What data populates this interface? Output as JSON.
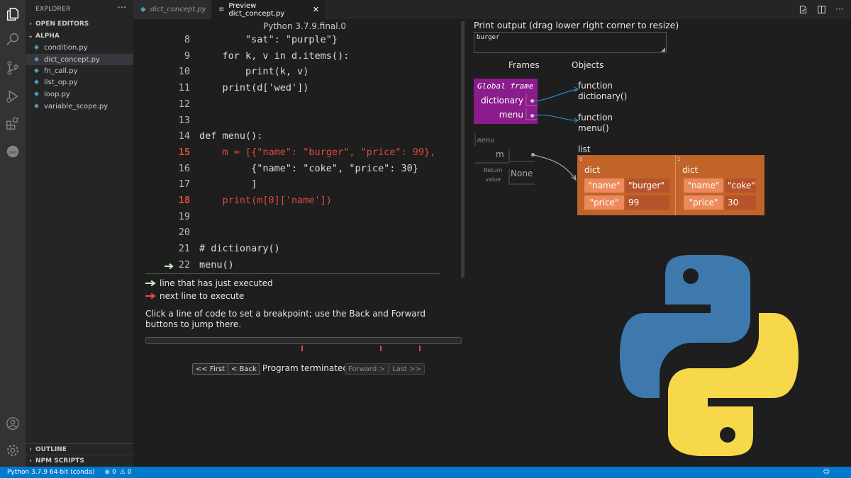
{
  "sidebar": {
    "title": "EXPLORER",
    "more": "···",
    "open_editors": "OPEN EDITORS",
    "folder": "ALPHA",
    "files": [
      "condition.py",
      "dict_concept.py",
      "fn_call.py",
      "list_op.py",
      "loop.py",
      "variable_scope.py"
    ],
    "outline": "OUTLINE",
    "npm_scripts": "NPM SCRIPTS"
  },
  "tabs": [
    {
      "label": "dict_concept.py"
    },
    {
      "label": "Preview dict_concept.py"
    }
  ],
  "code": {
    "python_version": "Python 3.7.9.final.0",
    "lines": [
      {
        "num": "8",
        "text": "        \"sat\": \"purple\"}",
        "highlight": false
      },
      {
        "num": "9",
        "text": "    for k, v in d.items():",
        "highlight": false
      },
      {
        "num": "10",
        "text": "        print(k, v)",
        "highlight": false
      },
      {
        "num": "11",
        "text": "    print(d['wed'])",
        "highlight": false
      },
      {
        "num": "12",
        "text": "",
        "highlight": false
      },
      {
        "num": "13",
        "text": "",
        "highlight": false
      },
      {
        "num": "14",
        "text": "def menu():",
        "highlight": false
      },
      {
        "num": "15",
        "text": "    m = [{\"name\": \"burger\", \"price\": 99},",
        "highlight": true
      },
      {
        "num": "16",
        "text": "         {\"name\": \"coke\", \"price\": 30}",
        "highlight": false
      },
      {
        "num": "17",
        "text": "         ]",
        "highlight": false
      },
      {
        "num": "18",
        "text": "    print(m[0]['name'])",
        "highlight": true
      },
      {
        "num": "19",
        "text": "",
        "highlight": false
      },
      {
        "num": "20",
        "text": "",
        "highlight": false
      },
      {
        "num": "21",
        "text": "# dictionary()",
        "highlight": false
      },
      {
        "num": "22",
        "text": "menu()",
        "highlight": false
      }
    ],
    "legend_executed": "line that has just executed",
    "legend_next": "next line to execute",
    "instructions": "Click a line of code to set a breakpoint; use the Back and Forward buttons to jump there.",
    "nav": {
      "first": "<< First",
      "back": "< Back",
      "status": "Program terminated",
      "forward": "Forward >",
      "last": "Last >>"
    }
  },
  "visualizer": {
    "print_label": "Print output (drag lower right corner to resize)",
    "print_value": "burger",
    "frames_header": "Frames",
    "objects_header": "Objects",
    "global_frame": {
      "title": "Global frame",
      "vars": [
        "dictionary",
        "menu"
      ]
    },
    "functions": [
      {
        "l1": "function",
        "l2": "dictionary()"
      },
      {
        "l1": "function",
        "l2": "menu()"
      }
    ],
    "menu_frame": {
      "title": "menu",
      "var": "m",
      "return_l1": "Return",
      "return_l2": "value",
      "return_val": "None"
    },
    "list_label": "list",
    "list_indices": [
      "0",
      "1"
    ],
    "dicts": [
      {
        "label": "dict",
        "rows": [
          {
            "k": "\"name\"",
            "v": "\"burger\""
          },
          {
            "k": "\"price\"",
            "v": "99"
          }
        ]
      },
      {
        "label": "dict",
        "rows": [
          {
            "k": "\"name\"",
            "v": "\"coke\""
          },
          {
            "k": "\"price\"",
            "v": "30"
          }
        ]
      }
    ]
  },
  "statusbar": {
    "python": "Python 3.7.9 64-bit (conda)",
    "errors": "0",
    "warnings": "0"
  },
  "colors": {
    "accent": "#007acc",
    "global_frame": "#8b1c8b",
    "list_bg": "#c0642a",
    "highlight_red": "#e04a3f",
    "executed_green": "#c6f1c1"
  }
}
